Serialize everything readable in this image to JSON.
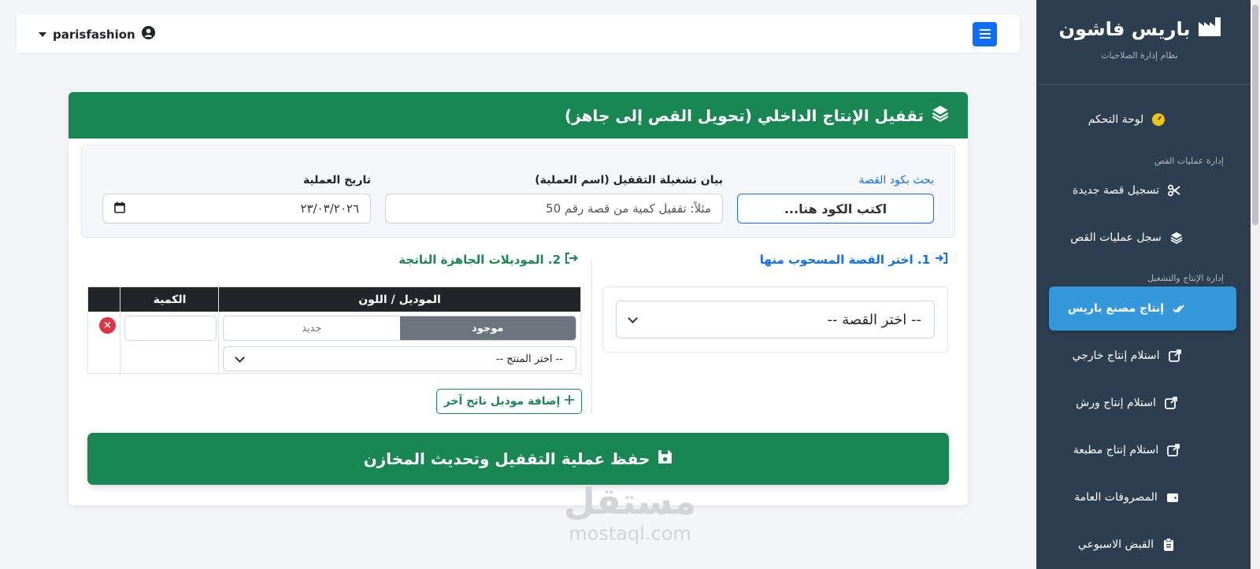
{
  "sidebar": {
    "brand_title": "باريس فاشون",
    "brand_subtitle": "نظام إدارة الصلاحيات",
    "dashboard": "لوحة التحكم",
    "section_cutting": "إدارة عمليات القص",
    "new_cut": "تسجيل قصة جديدة",
    "cut_log": "سجل عمليات القص",
    "section_production": "إدارة الإنتاج والتشغيل",
    "factory_production": "إنتاج مصنع باريس",
    "external_receive": "استلام إنتاج خارجي",
    "workshop_receive": "استلام إنتاج ورش",
    "printer_receive": "استلام إنتاج مطبعة",
    "general_expenses": "المصروفات العامة",
    "weekly_pay": "القبض الاسبوعي"
  },
  "topbar": {
    "username": "parisfashion"
  },
  "card": {
    "title": "تقفيل الإنتاج الداخلي (تحويل القص إلى جاهز)",
    "search_label": "بحث بكود القصة",
    "search_placeholder": "اكتب الكود هنا...",
    "statement_label": "بيان تشغيلة التقفيل (اسم العملية)",
    "statement_placeholder": "مثلاً: تقفيل كمية من قصة رقم 50",
    "date_label": "تاريخ العملية",
    "date_value": "٢٣/٠٣/٢٠٢٦",
    "step1_title": "1. اختر القصة المسحوب منها",
    "step1_select": "-- اختر القصة --",
    "step2_title": "2. الموديلات الجاهزة الناتجة",
    "col_model": "الموديل / اللون",
    "col_qty": "الكمية",
    "toggle_existing": "موجود",
    "toggle_new": "جديد",
    "product_select": "-- اختر المنتج --",
    "delete_symbol": "×",
    "add_model": "إضافة موديل ناتج آخر",
    "save": "حفظ عملية التقفيل وتحديث المخازن"
  },
  "watermark": {
    "arabic": "مستقل",
    "latin": "mostaql.com"
  }
}
